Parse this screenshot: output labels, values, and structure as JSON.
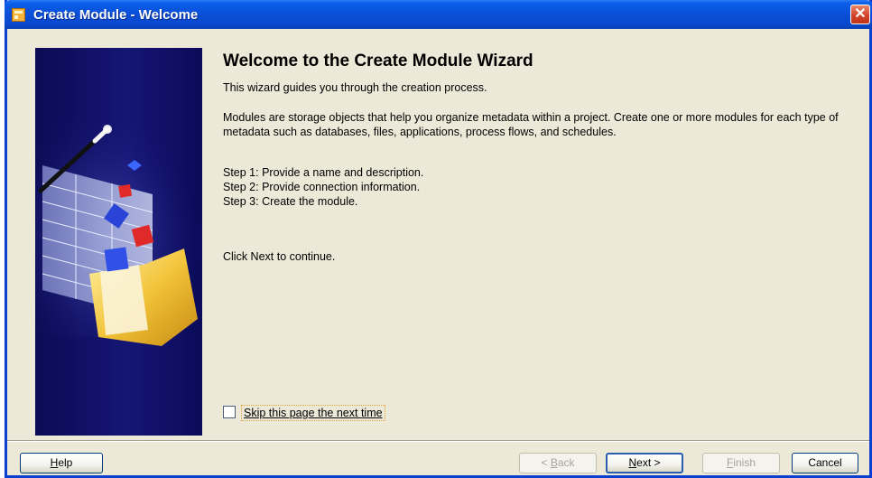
{
  "window": {
    "title": "Create Module - Welcome",
    "close_glyph": "✕"
  },
  "content": {
    "heading": "Welcome to the Create Module Wizard",
    "intro": "This wizard guides you through the creation process.",
    "description": "Modules are storage objects that help you organize metadata within a project. Create one or more modules for each type of metadata such as databases, files, applications, process flows, and schedules.",
    "steps": [
      "Step 1: Provide a name and description.",
      "Step 2: Provide connection information.",
      "Step 3: Create the module."
    ],
    "continue_text": "Click Next to continue."
  },
  "skip": {
    "label": "Skip this page the next time",
    "checked": false
  },
  "buttons": {
    "help": {
      "first": "H",
      "rest": "elp"
    },
    "back": {
      "prefix": "< ",
      "first": "B",
      "rest": "ack"
    },
    "next": {
      "first": "N",
      "rest": "ext >"
    },
    "finish": {
      "first": "F",
      "rest": "inish"
    },
    "cancel": "Cancel"
  },
  "colors": {
    "title_bar": "#0a4fd8",
    "sidebar": "#151575",
    "dialog_bg": "#ece9d8"
  }
}
